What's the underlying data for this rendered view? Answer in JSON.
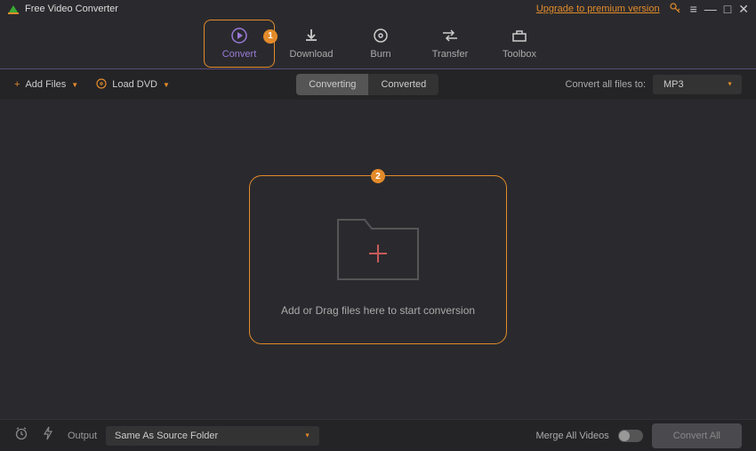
{
  "app": {
    "title": "Free Video Converter",
    "upgrade": "Upgrade to premium version"
  },
  "nav": {
    "items": [
      {
        "label": "Convert"
      },
      {
        "label": "Download"
      },
      {
        "label": "Burn"
      },
      {
        "label": "Transfer"
      },
      {
        "label": "Toolbox"
      }
    ],
    "badge1": "1"
  },
  "toolbar": {
    "add_files": "Add Files",
    "load_dvd": "Load DVD",
    "tab_converting": "Converting",
    "tab_converted": "Converted",
    "target_label": "Convert all files to:",
    "target_value": "MP3"
  },
  "dropzone": {
    "badge": "2",
    "text": "Add or Drag files here to start conversion"
  },
  "footer": {
    "output_label": "Output",
    "output_value": "Same As Source Folder",
    "merge_label": "Merge All Videos",
    "convert_all": "Convert All"
  }
}
